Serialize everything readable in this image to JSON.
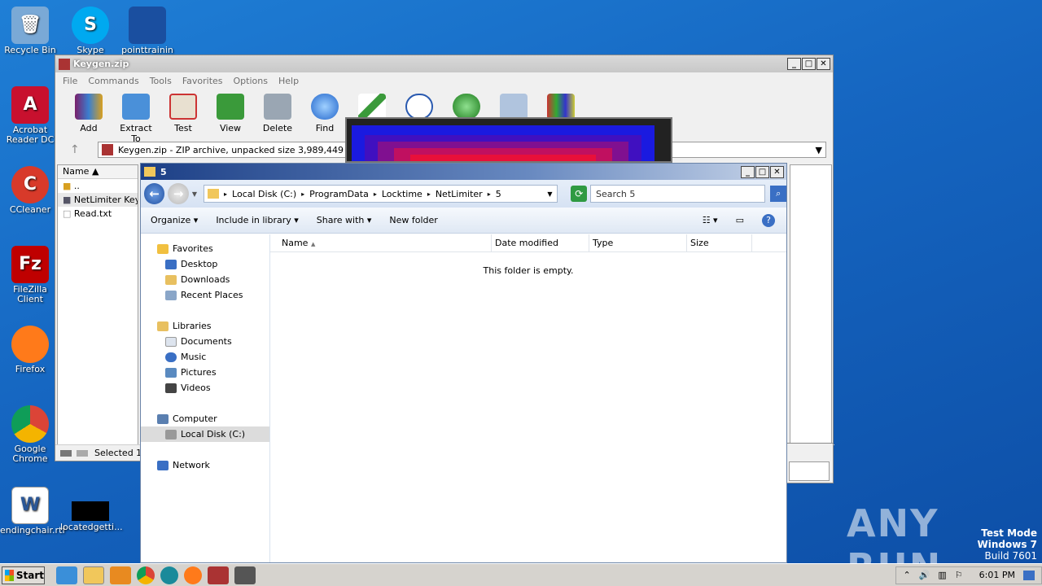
{
  "desktop": {
    "icons": [
      {
        "label": "Recycle Bin",
        "icon": "recycle-bin-icon",
        "color": "#7aa9d6"
      },
      {
        "label": "Skype",
        "icon": "skype-icon",
        "color": "#00a9f0"
      },
      {
        "label": "pointtrainin",
        "icon": "file-icon",
        "color": "#1a4fa0"
      },
      {
        "label": "Acrobat Reader DC",
        "icon": "acrobat-icon",
        "color": "#c8102e"
      },
      {
        "label": "CCleaner",
        "icon": "ccleaner-icon",
        "color": "#d83a2a"
      },
      {
        "label": "FileZilla Client",
        "icon": "filezilla-icon",
        "color": "#bf0000"
      },
      {
        "label": "Firefox",
        "icon": "firefox-icon",
        "color": "#ff7a1a"
      },
      {
        "label": "Google Chrome",
        "icon": "chrome-icon",
        "color": "#2e9e4f"
      },
      {
        "label": "endingchair.rtf",
        "icon": "word-document-icon",
        "color": "#2b5797"
      },
      {
        "label": "locatedgetti...",
        "icon": "file-icon",
        "color": "#000000"
      }
    ]
  },
  "winrar": {
    "title": "Keygen.zip",
    "menu": [
      "File",
      "Commands",
      "Tools",
      "Favorites",
      "Options",
      "Help"
    ],
    "toolbar": [
      "Add",
      "Extract To",
      "Test",
      "View",
      "Delete",
      "Find"
    ],
    "address": "Keygen.zip - ZIP archive, unpacked size 3,989,449 bytes",
    "list_header": "Name",
    "files": [
      "..",
      "NetLimiter Keyg",
      "Read.txt"
    ],
    "status": "Selected 1"
  },
  "explorer": {
    "title": "5",
    "breadcrumb": [
      "Local Disk (C:)",
      "ProgramData",
      "Locktime",
      "NetLimiter",
      "5"
    ],
    "search_placeholder": "Search 5",
    "commands": [
      "Organize",
      "Include in library",
      "Share with",
      "New folder"
    ],
    "nav": {
      "favorites_label": "Favorites",
      "favorites": [
        "Desktop",
        "Downloads",
        "Recent Places"
      ],
      "libraries_label": "Libraries",
      "libraries": [
        "Documents",
        "Music",
        "Pictures",
        "Videos"
      ],
      "computer_label": "Computer",
      "computer": [
        "Local Disk (C:)"
      ],
      "network_label": "Network"
    },
    "columns": [
      "Name",
      "Date modified",
      "Type",
      "Size"
    ],
    "empty_message": "This folder is empty."
  },
  "taskbar": {
    "start_label": "Start",
    "clock": "6:01 PM"
  },
  "watermark": "ANY RUN",
  "testmode": {
    "line1": "Test Mode",
    "line2": "Windows 7",
    "line3": "Build 7601"
  }
}
